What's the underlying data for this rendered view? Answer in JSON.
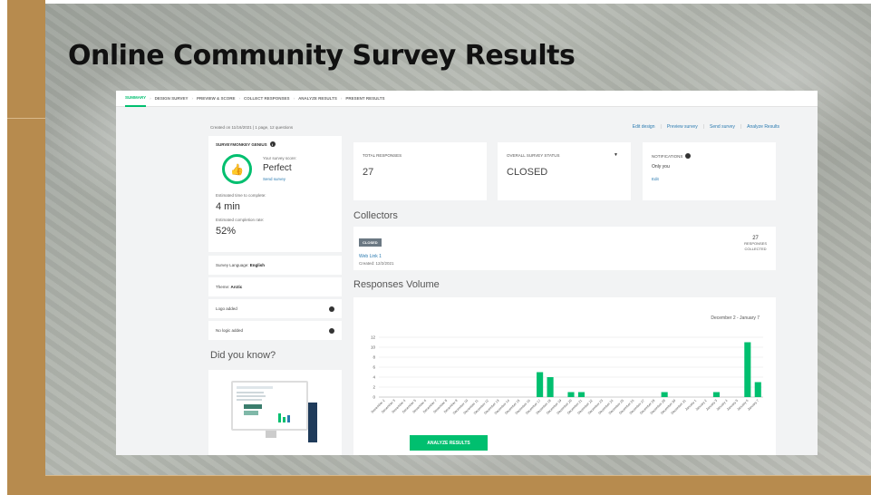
{
  "slide": {
    "title": "Online Community Survey Results"
  },
  "nav": {
    "tabs": [
      "SUMMARY",
      "DESIGN SURVEY",
      "PREVIEW & SCORE",
      "COLLECT RESPONSES",
      "ANALYZE RESULTS",
      "PRESENT RESULTS"
    ],
    "active": "SUMMARY"
  },
  "meta": {
    "created": "Created on 11/16/2021 | 1 page, 12 questions"
  },
  "links": [
    "Edit design",
    "Preview survey",
    "Send survey",
    "Analyze Results"
  ],
  "genius": {
    "header": "SURVEYMONKEY GENIUS",
    "score_label": "Your survey score:",
    "score": "Perfect",
    "send_link": "Send survey",
    "est_time_label": "Estimated time to complete:",
    "est_time": "4 min",
    "est_rate_label": "Estimated completion rate:",
    "est_rate": "52%"
  },
  "settings": {
    "language_label": "Survey Language:",
    "language": "English",
    "theme_label": "Theme:",
    "theme": "Arctic",
    "logo": "Logo added",
    "logic": "No logic added"
  },
  "did_you_know": "Did you know?",
  "stats": {
    "total_label": "TOTAL RESPONSES",
    "total": "27",
    "status_label": "OVERALL SURVEY STATUS",
    "status": "CLOSED",
    "notif_label": "NOTIFICATIONS",
    "notif_value": "Only you",
    "notif_edit": "Edit"
  },
  "collectors": {
    "heading": "Collectors",
    "badge": "CLOSED",
    "name": "Web Link 1",
    "created": "Created: 12/2/2021",
    "responses": "27",
    "responses_label1": "RESPONSES",
    "responses_label2": "COLLECTED"
  },
  "volume": {
    "heading": "Responses Volume",
    "date_range": "December 2 - January 7",
    "button": "ANALYZE RESULTS"
  },
  "colors": {
    "accent": "#00bf6f",
    "link": "#2a7ab0"
  },
  "chart_data": {
    "type": "bar",
    "title": "",
    "xlabel": "",
    "ylabel": "",
    "ylim": [
      0,
      12
    ],
    "yticks": [
      0,
      2,
      4,
      6,
      8,
      10,
      12
    ],
    "categories": [
      "December 2",
      "December 3",
      "December 4",
      "December 5",
      "December 6",
      "December 7",
      "December 8",
      "December 9",
      "December 10",
      "December 11",
      "December 12",
      "December 13",
      "December 14",
      "December 15",
      "December 16",
      "December 17",
      "December 18",
      "December 19",
      "December 20",
      "December 21",
      "December 22",
      "December 23",
      "December 24",
      "December 25",
      "December 26",
      "December 27",
      "December 28",
      "December 29",
      "December 30",
      "December 31",
      "January 1",
      "January 2",
      "January 3",
      "January 4",
      "January 5",
      "January 6",
      "January 7"
    ],
    "values": [
      0,
      0,
      0,
      0,
      0,
      0,
      0,
      0,
      0,
      0,
      0,
      0,
      0,
      0,
      0,
      5,
      4,
      0,
      1,
      1,
      0,
      0,
      0,
      0,
      0,
      0,
      0,
      1,
      0,
      0,
      0,
      0,
      1,
      0,
      0,
      11,
      3
    ],
    "color": "#00bf6f"
  }
}
